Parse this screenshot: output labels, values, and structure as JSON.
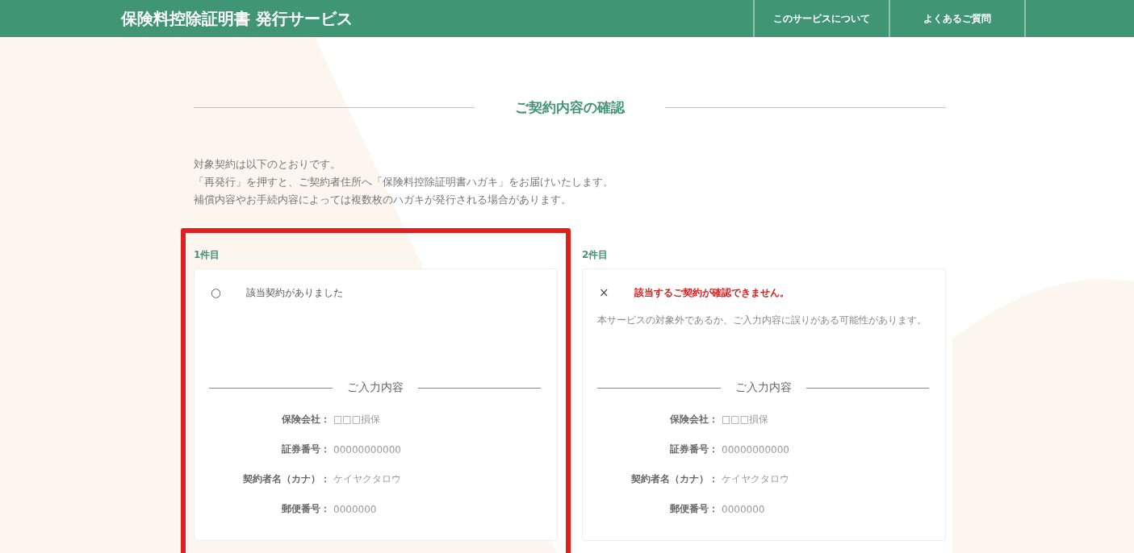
{
  "header": {
    "title": "保険料控除証明書 発行サービス",
    "nav": [
      {
        "label": "このサービスについて"
      },
      {
        "label": "よくあるご質問"
      }
    ]
  },
  "section_title": "ご契約内容の確認",
  "intro": [
    "対象契約は以下のとおりです。",
    "「再発行」を押すと、ご契約者住所へ「保険料控除証明書ハガキ」をお届けいたします。",
    "補償内容やお手続内容によっては複数枚のハガキが発行される場合があります。"
  ],
  "contracts": [
    {
      "label": "1件目",
      "highlighted": true,
      "kind": "found",
      "mark": "○",
      "status": "該当契約がありました",
      "input_title": "ご入力内容",
      "fields": [
        {
          "label": "保険会社：",
          "value": "□□□損保"
        },
        {
          "label": "証券番号：",
          "value": "00000000000"
        },
        {
          "label": "契約者名（カナ）：",
          "value": "ケイヤクタロウ"
        },
        {
          "label": "郵便番号：",
          "value": "0000000"
        }
      ]
    },
    {
      "label": "2件目",
      "highlighted": false,
      "kind": "not_found",
      "mark": "×",
      "status": "該当するご契約が確認できません。",
      "note": "本サービスの対象外であるか、ご入力内容に誤りがある可能性があります。",
      "input_title": "ご入力内容",
      "fields": [
        {
          "label": "保険会社：",
          "value": "□□□損保"
        },
        {
          "label": "証券番号：",
          "value": "00000000000"
        },
        {
          "label": "契約者名（カナ）：",
          "value": "ケイヤクタロウ"
        },
        {
          "label": "郵便番号：",
          "value": "0000000"
        }
      ]
    }
  ]
}
